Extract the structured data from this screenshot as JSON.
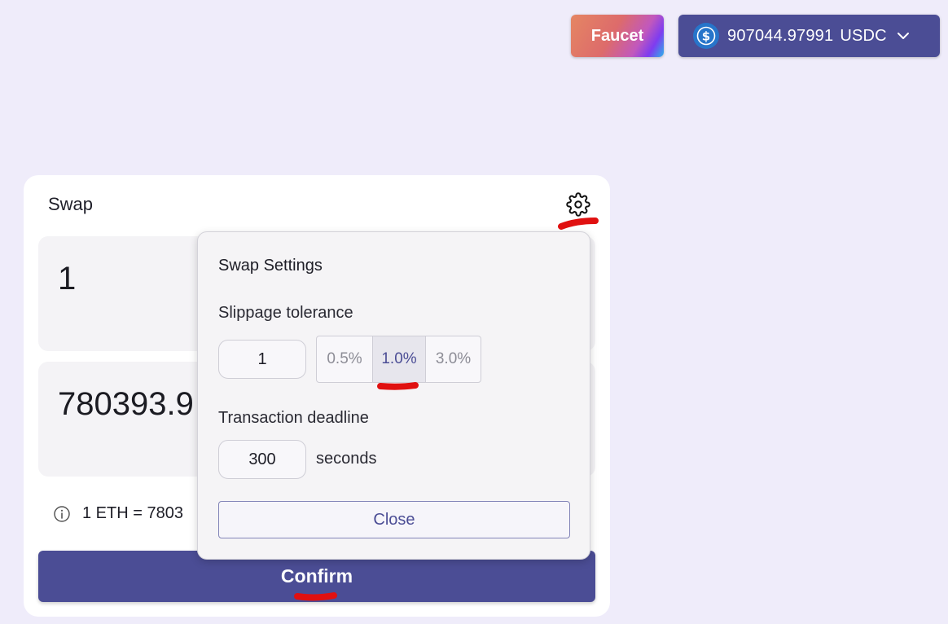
{
  "header": {
    "faucet_label": "Faucet",
    "wallet": {
      "balance": "907044.97991",
      "currency": "USDC",
      "icon": "usdc-coin-icon",
      "accent": "#4b4d95"
    }
  },
  "swap": {
    "title": "Swap",
    "settings_icon": "gear-icon",
    "from_amount": "1",
    "to_amount": "780393.9",
    "rate_text": "1 ETH = 7803",
    "confirm_label": "Confirm"
  },
  "settings": {
    "title": "Swap Settings",
    "slippage_label": "Slippage tolerance",
    "slippage_value": "1",
    "presets": [
      "0.5%",
      "1.0%",
      "3.0%"
    ],
    "selected_preset": "1.0%",
    "deadline_label": "Transaction deadline",
    "deadline_value": "300",
    "deadline_unit": "seconds",
    "close_label": "Close"
  },
  "colors": {
    "background": "#efecfa",
    "primary": "#4b4d95",
    "annotation": "#e01010"
  }
}
